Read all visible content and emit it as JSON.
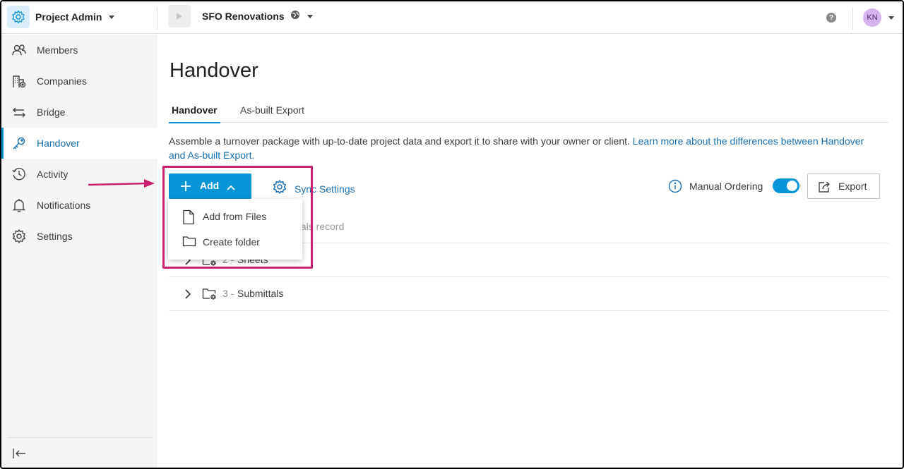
{
  "topbar": {
    "app_name": "Project Admin",
    "project_name": "SFO Renovations",
    "help_glyph": "?",
    "user_initials": "KN"
  },
  "sidebar": {
    "items": [
      {
        "label": "Members",
        "icon": "members-icon"
      },
      {
        "label": "Companies",
        "icon": "companies-icon"
      },
      {
        "label": "Bridge",
        "icon": "bridge-icon"
      },
      {
        "label": "Handover",
        "icon": "key-icon",
        "active": true
      },
      {
        "label": "Activity",
        "icon": "activity-icon"
      },
      {
        "label": "Notifications",
        "icon": "bell-icon"
      },
      {
        "label": "Settings",
        "icon": "gear-icon"
      }
    ]
  },
  "main": {
    "title": "Handover",
    "tabs": [
      {
        "label": "Handover",
        "active": true
      },
      {
        "label": "As-built Export",
        "active": false
      }
    ],
    "description": "Assemble a turnover package with up-to-date project data and export it to share with your owner or client.",
    "description_link": "Learn more about the differences between Handover and As-built Export.",
    "add_label": "Add",
    "sync_label": "Sync Settings",
    "manual_ordering_label": "Manual Ordering",
    "manual_ordering_on": true,
    "export_label": "Export",
    "partial_row_text": "tals record",
    "rows": [
      {
        "num": "2 -",
        "name": "Sheets"
      },
      {
        "num": "3 -",
        "name": "Submittals"
      }
    ]
  },
  "add_menu": {
    "items": [
      {
        "label": "Add from Files",
        "icon": "file-icon"
      },
      {
        "label": "Create folder",
        "icon": "folder-icon"
      }
    ]
  },
  "colors": {
    "accent": "#0696d7",
    "link": "#1a6fb0",
    "annotation": "#c8206e"
  }
}
